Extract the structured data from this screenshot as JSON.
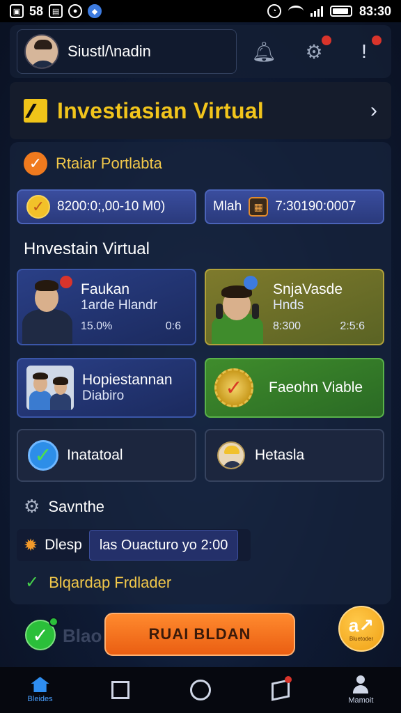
{
  "status_bar": {
    "left_text": "58",
    "time": "83:30",
    "icons": [
      "screenshot-icon",
      "gallery-icon",
      "messenger-icon",
      "alarm-icon",
      "wifi-icon",
      "signal-icon",
      "battery-icon"
    ]
  },
  "header": {
    "username": "Siustl/\\nadin",
    "icons": [
      "bell-icon",
      "settings-icon",
      "alert-icon"
    ]
  },
  "banner": {
    "title": "Investiasian Virtual"
  },
  "portfolio": {
    "label": "Rtaiar Portlabta",
    "balance_text": "8200:0;,00-10 M0)",
    "second_label": "Mlah",
    "second_value": "7:30190:0007"
  },
  "section": {
    "title": "Hnvestain Virtual"
  },
  "cards": [
    {
      "title": "Faukan",
      "subtitle": "1arde Hlandr",
      "stat_left": "15.0%",
      "stat_right": "0:6",
      "color": "blue"
    },
    {
      "title": "SnjaVasde",
      "subtitle": "Hnds",
      "stat_left": "8:300",
      "stat_right": "2:5:6",
      "color": "gold"
    },
    {
      "title": "Hopiestannan",
      "subtitle": "Diabiro",
      "color": "blue"
    },
    {
      "title": "Faeohn Viable",
      "color": "green"
    },
    {
      "title": "Inatatoal",
      "color": "dark"
    },
    {
      "title": "Hetasla",
      "color": "dark"
    }
  ],
  "settings": {
    "label": "Savnthe",
    "row_label": "Dlesp",
    "row_value": "las Ouacturo yo 2:00",
    "promo_text": "Blqardap Frdlader"
  },
  "bottom": {
    "ghost_text": "Blao",
    "cta_label": "RUAI BLDAN",
    "fab_glyph": "a↗",
    "fab_caption": "Bluetoder"
  },
  "navbar": {
    "home_label": "Bleides",
    "profile_label": "Mamoit"
  },
  "colors": {
    "accent_gold": "#f2c51c",
    "cta_orange": "#ea5e12",
    "card_blue": "#2a3f86",
    "card_green": "#3f8c2c",
    "home_blue": "#2f8ef0"
  }
}
